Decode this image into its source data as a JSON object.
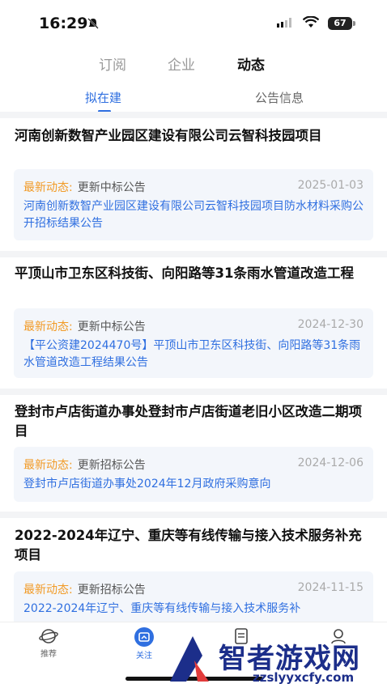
{
  "status": {
    "time": "16:29",
    "battery": "67"
  },
  "top_tabs": [
    "订阅",
    "企业",
    "动态"
  ],
  "sub_tabs": [
    "拟在建",
    "公告信息"
  ],
  "latest_label": "最新动态:",
  "projects": [
    {
      "title": "河南创新数智产业园区建设有限公司云智科技园项目",
      "type": "更新中标公告",
      "date": "2025-01-03",
      "desc": "河南创新数智产业园区建设有限公司云智科技园项目防水材料采购公开招标结果公告"
    },
    {
      "title": "平顶山市卫东区科技街、向阳路等31条雨水管道改造工程",
      "type": "更新中标公告",
      "date": "2024-12-30",
      "desc": "【平公资建2024470号】平顶山市卫东区科技街、向阳路等31条雨水管道改造工程结果公告"
    },
    {
      "title": "登封市卢店街道办事处登封市卢店街道老旧小区改造二期项目",
      "type": "更新招标公告",
      "date": "2024-12-06",
      "desc": "登封市卢店街道办事处2024年12月政府采购意向"
    },
    {
      "title": "2022-2024年辽宁、重庆等有线传输与接入技术服务补充项目",
      "type": "更新招标公告",
      "date": "2024-11-15",
      "desc": "2022-2024年辽宁、重庆等有线传输与接入技术服务补"
    }
  ],
  "nav": [
    "推荐",
    "关注"
  ],
  "watermark": {
    "title": "智者游戏网",
    "url": "zzslyyxcfy.com"
  },
  "colors": {
    "accent": "#2f6fe0",
    "label_orange": "#f29b27",
    "box_bg": "#f3f6fb"
  }
}
